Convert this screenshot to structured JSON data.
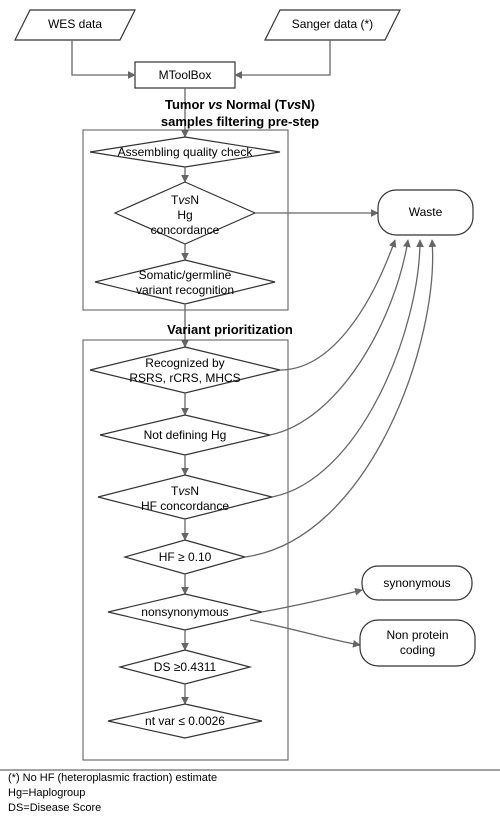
{
  "inputs": {
    "wes": "WES data",
    "sanger": "Sanger data (*)"
  },
  "mtoolbox": "MToolBox",
  "section1": {
    "title_line1": "Tumor vs Normal (TvsN)",
    "title_line2": "samples filtering pre-step"
  },
  "pre_step": {
    "assembly": "Assembling quality check",
    "tvsn_hg_line1": "TvsN",
    "tvsn_hg_line2": "Hg",
    "tvsn_hg_line3": "concordance",
    "somatic_line1": "Somatic/germline",
    "somatic_line2": "variant recognition"
  },
  "section2": {
    "title": "Variant prioritization"
  },
  "prioritization": {
    "recognized_line1": "Recognized by",
    "recognized_line2": "RSRS, rCRS, MHCS",
    "not_defining": "Not defining Hg",
    "tvsn_hf_line1": "TvsN",
    "tvsn_hf_line2": "HF concordance",
    "hf_threshold": "HF ≥ 0.10",
    "nonsynonymous": "nonsynonymous",
    "ds_threshold": "DS ≥0.4311",
    "nt_var": "nt var ≤ 0.0026"
  },
  "outputs": {
    "waste": "Waste",
    "synonymous": "synonymous",
    "non_protein_line1": "Non protein",
    "non_protein_line2": "coding"
  },
  "legend": {
    "note1": "(*) No HF (heteroplasmic fraction) estimate",
    "note2": "Hg=Haplogroup",
    "note3": "DS=Disease Score"
  },
  "chart_data": {
    "type": "flowchart",
    "nodes": [
      {
        "id": "wes",
        "shape": "parallelogram",
        "label": "WES data"
      },
      {
        "id": "sanger",
        "shape": "parallelogram",
        "label": "Sanger data (*)"
      },
      {
        "id": "mtoolbox",
        "shape": "rectangle",
        "label": "MToolBox"
      },
      {
        "id": "assembly",
        "shape": "diamond",
        "label": "Assembling quality check"
      },
      {
        "id": "tvsn_hg",
        "shape": "diamond",
        "label": "TvsN Hg concordance"
      },
      {
        "id": "somatic",
        "shape": "diamond",
        "label": "Somatic/germline variant recognition"
      },
      {
        "id": "recognized",
        "shape": "diamond",
        "label": "Recognized by RSRS, rCRS, MHCS"
      },
      {
        "id": "not_def_hg",
        "shape": "diamond",
        "label": "Not defining Hg"
      },
      {
        "id": "tvsn_hf",
        "shape": "diamond",
        "label": "TvsN HF concordance"
      },
      {
        "id": "hf",
        "shape": "diamond",
        "label": "HF ≥ 0.10"
      },
      {
        "id": "nonsyn",
        "shape": "diamond",
        "label": "nonsynonymous"
      },
      {
        "id": "ds",
        "shape": "diamond",
        "label": "DS ≥0.4311"
      },
      {
        "id": "ntvar",
        "shape": "diamond",
        "label": "nt var ≤ 0.0026"
      },
      {
        "id": "waste",
        "shape": "rounded",
        "label": "Waste"
      },
      {
        "id": "synonymous",
        "shape": "rounded",
        "label": "synonymous"
      },
      {
        "id": "non_protein",
        "shape": "rounded",
        "label": "Non protein coding"
      }
    ],
    "edges": [
      [
        "wes",
        "mtoolbox"
      ],
      [
        "sanger",
        "mtoolbox"
      ],
      [
        "mtoolbox",
        "assembly"
      ],
      [
        "assembly",
        "tvsn_hg"
      ],
      [
        "tvsn_hg",
        "somatic"
      ],
      [
        "tvsn_hg",
        "waste"
      ],
      [
        "somatic",
        "recognized"
      ],
      [
        "recognized",
        "not_def_hg"
      ],
      [
        "recognized",
        "waste"
      ],
      [
        "not_def_hg",
        "tvsn_hf"
      ],
      [
        "not_def_hg",
        "waste"
      ],
      [
        "tvsn_hf",
        "hf"
      ],
      [
        "tvsn_hf",
        "waste"
      ],
      [
        "hf",
        "nonsyn"
      ],
      [
        "hf",
        "waste"
      ],
      [
        "nonsyn",
        "ds"
      ],
      [
        "nonsyn",
        "synonymous"
      ],
      [
        "nonsyn",
        "non_protein"
      ],
      [
        "ds",
        "ntvar"
      ]
    ],
    "groups": [
      {
        "title": "Tumor vs Normal (TvsN) samples filtering pre-step",
        "members": [
          "assembly",
          "tvsn_hg",
          "somatic"
        ]
      },
      {
        "title": "Variant prioritization",
        "members": [
          "recognized",
          "not_def_hg",
          "tvsn_hf",
          "hf",
          "nonsyn",
          "ds",
          "ntvar"
        ]
      }
    ]
  }
}
